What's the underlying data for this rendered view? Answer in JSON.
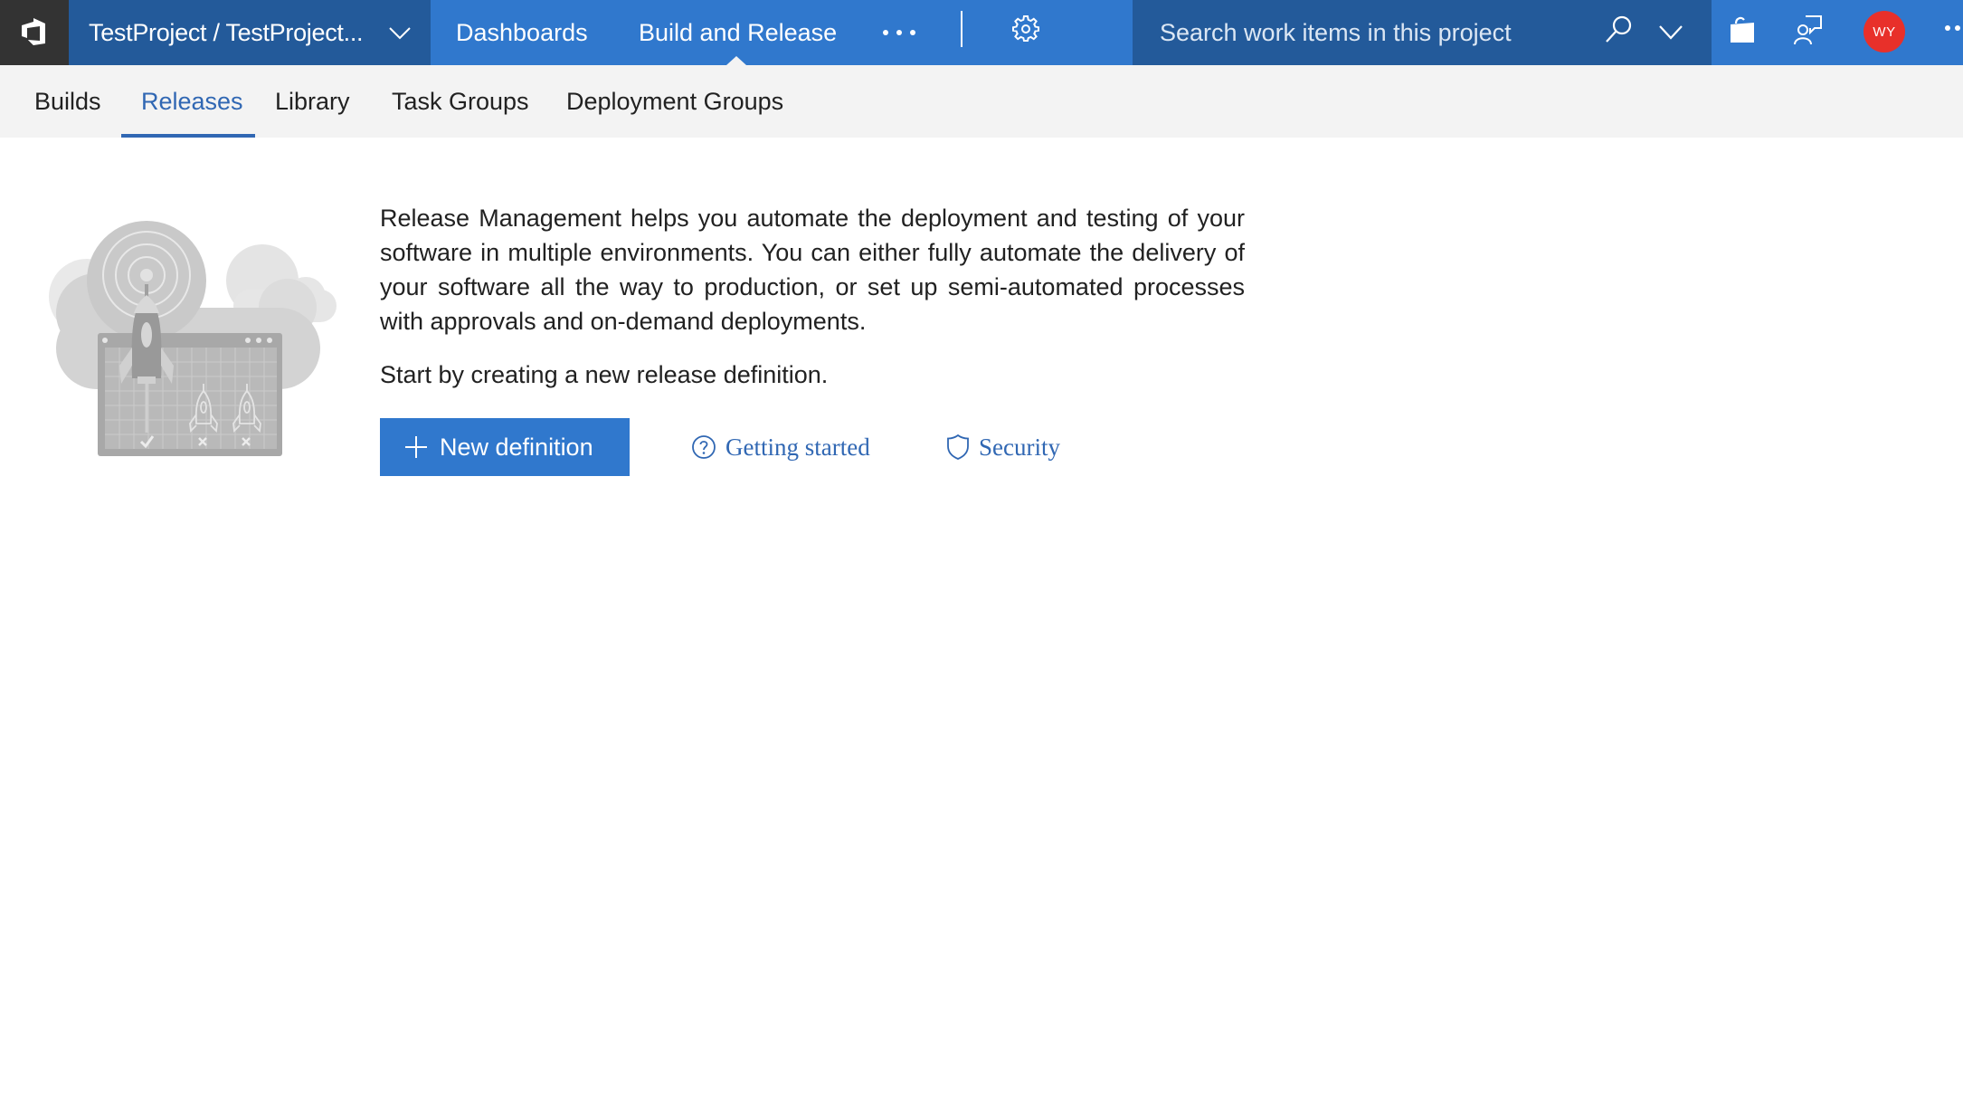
{
  "header": {
    "project_selector": "TestProject / TestProject...",
    "hubs": [
      {
        "label": "Dashboards",
        "active": false
      },
      {
        "label": "Build and Release",
        "active": true
      }
    ],
    "search_placeholder": "Search work items in this project",
    "user_initials": "WY",
    "icons": {
      "logo": "vsts-logo-icon",
      "project_chevron": "chevron-down-icon",
      "more_hubs": "ellipsis-icon",
      "settings": "gear-icon",
      "search": "search-icon",
      "search_chevron": "chevron-down-icon",
      "marketplace": "shopping-bag-icon",
      "feedback": "feedback-person-icon",
      "more_user": "ellipsis-icon"
    }
  },
  "subnav": {
    "items": [
      {
        "label": "Builds",
        "active": false
      },
      {
        "label": "Releases",
        "active": true
      },
      {
        "label": "Library",
        "active": false
      },
      {
        "label": "Task Groups",
        "active": false
      },
      {
        "label": "Deployment Groups",
        "active": false
      }
    ]
  },
  "main": {
    "description": "Release Management helps you automate the deployment and testing of your software in multiple environments. You can either fully automate the delivery of your software all the way to production, or set up semi-automated processes with approvals and on-demand deployments.",
    "start_text": "Start by creating a new release definition.",
    "new_definition_label": "New definition",
    "getting_started_label": "Getting started",
    "security_label": "Security",
    "illustration": "release-rocket-cloud-illustration"
  },
  "colors": {
    "brand_blue": "#3078cd",
    "dark_blue": "#235a9a",
    "logo_bg": "#333333",
    "subnav_bg": "#f3f3f3",
    "active_tab": "#3067b3",
    "avatar_bg": "#e8302a"
  }
}
